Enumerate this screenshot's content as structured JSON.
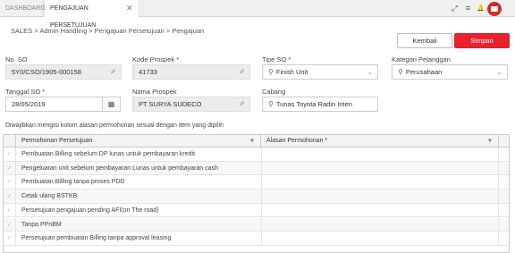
{
  "tabs": {
    "dashboard": "DASHBOARD",
    "pengajuan": "PENGAJUAN PERSETUJUAN",
    "close": "✕"
  },
  "toolbar": {
    "expand_icon": "⤢",
    "menu_icon": "≡",
    "bell_icon": "🔔"
  },
  "breadcrumb": "SALES > Admin Handling > Pengajuan Persetujuan > Pengajuan",
  "buttons": {
    "kembali": "Kembali",
    "simpan": "Simpan"
  },
  "form": {
    "no_so": {
      "label": "No. SO",
      "value": "5Y0/CSO/1905-000158"
    },
    "kode_prospek": {
      "label": "Kode Prospek *",
      "value": "41733"
    },
    "tipe_so": {
      "label": "Tipe SO *",
      "value": "Finish Unit"
    },
    "kategori": {
      "label": "Kategori Pelanggan",
      "value": "Perusahaan"
    },
    "tanggal_so": {
      "label": "Tanggal SO *",
      "value": "28/05/2019"
    },
    "nama_prospek": {
      "label": "Nama Prospek",
      "value": "PT SURYA SUDECO"
    },
    "cabang": {
      "label": "Cabang",
      "value": "Tunas Toyota Radin Inten"
    }
  },
  "note": "Diwajibkan mengisi kolom alasan permohonan sesuai dengan item yang dipilih",
  "grid": {
    "headers": {
      "permohonan": "Permohonan Persetujuan",
      "alasan": "Alasan Permohonan *"
    },
    "rows": [
      "Pembuatan Billing sebelum DP lunas untuk pembayaran kredit",
      "Pengeluaran unit sebelum pembayaran Lunas untuk pembayaran cash",
      "Pembuatan Billing tanpa proses PDD",
      "Cetak ulang BSTKB",
      "Persetujuan pengajuan pending AFI(on The road)",
      "Tanpa PPnBM",
      "Persetujuan pembuatan Billing tanpa approval leasing"
    ]
  },
  "colors": {
    "accent": "#e8232d",
    "readonly_bg": "#ececec"
  }
}
